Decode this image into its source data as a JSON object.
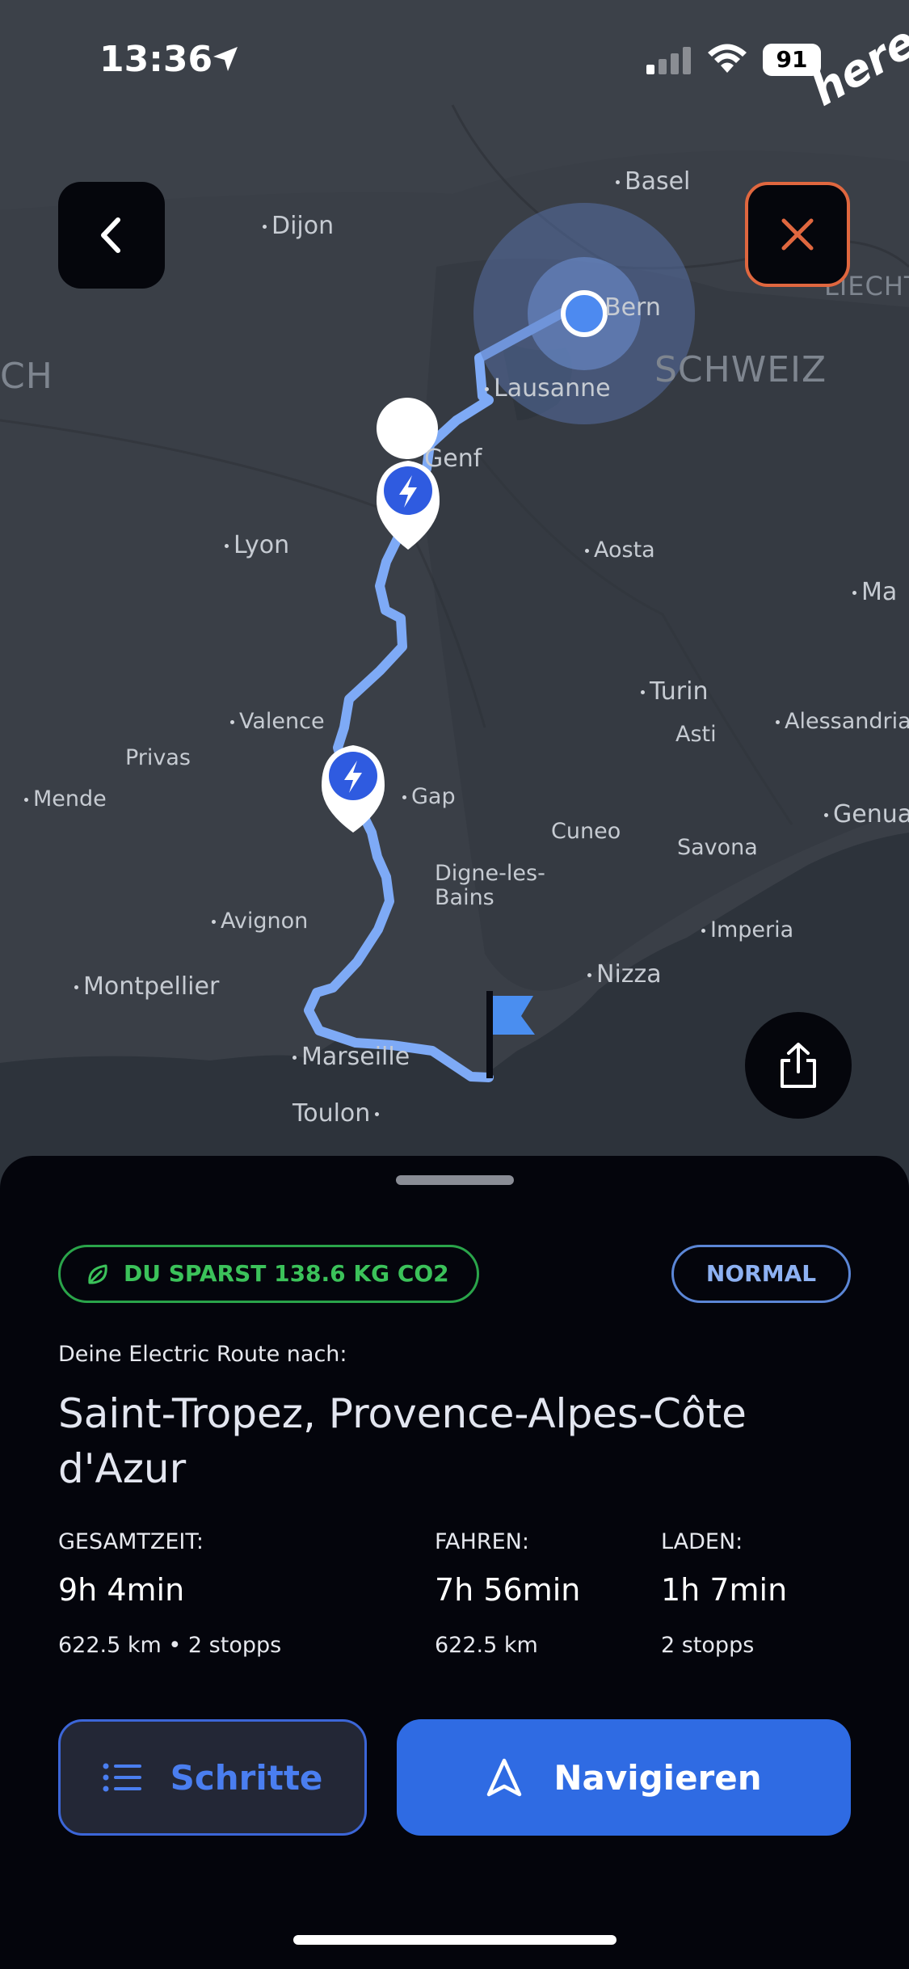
{
  "status_bar": {
    "time": "13:36",
    "battery": "91"
  },
  "brand": {
    "logo_text": "here"
  },
  "map": {
    "cities": {
      "basel": "Basel",
      "dijon": "Dijon",
      "bern": "Bern",
      "lausanne": "Lausanne",
      "genf": "Genf",
      "lyon": "Lyon",
      "aosta": "Aosta",
      "ma": "Ma",
      "turin": "Turin",
      "asti": "Asti",
      "alessandria": "Alessandria",
      "valence": "Valence",
      "privas": "Privas",
      "mende": "Mende",
      "gap": "Gap",
      "cuneo": "Cuneo",
      "savona": "Savona",
      "genua": "Genua",
      "digne": "Digne-les-Bains",
      "avignon": "Avignon",
      "imperia": "Imperia",
      "montpellier": "Montpellier",
      "nizza": "Nizza",
      "marseille": "Marseille",
      "toulon": "Toulon"
    },
    "countries": {
      "schweiz": "SCHWEIZ",
      "liechtenstein": "LIECHTEN",
      "ch": "CH"
    }
  },
  "sheet": {
    "co2_badge": "DU SPARST 138.6 KG CO2",
    "mode_badge": "NORMAL",
    "subtitle": "Deine Electric Route nach:",
    "destination": "Saint-Tropez, Provence-Alpes-Côte d'Azur",
    "stats": {
      "total": {
        "label": "GESAMTZEIT:",
        "value": "9h 4min",
        "sub": "622.5 km • 2 stopps"
      },
      "drive": {
        "label": "FAHREN:",
        "value": "7h 56min",
        "sub": "622.5 km"
      },
      "charge": {
        "label": "LADEN:",
        "value": "1h 7min",
        "sub": "2 stopps"
      }
    },
    "steps_label": "Schritte",
    "navigate_label": "Navigieren"
  },
  "colors": {
    "accent": "#2f6be3",
    "route": "#7eaaf6",
    "co2_green": "#3bc25a",
    "close_orange": "#e0673f"
  }
}
